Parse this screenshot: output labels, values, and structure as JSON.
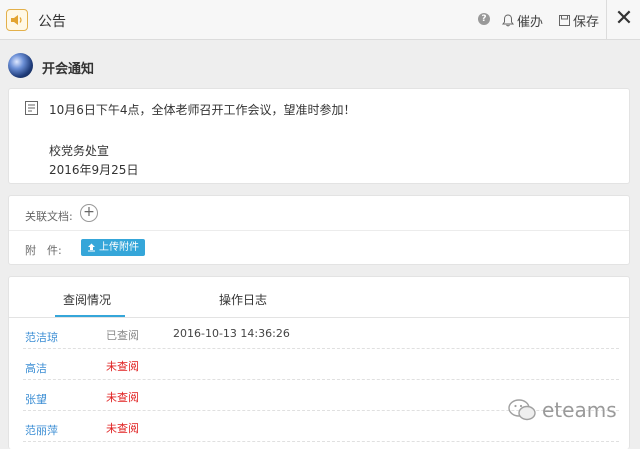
{
  "header": {
    "title": "公告",
    "help_symbol": "?",
    "urge_label": "催办",
    "save_label": "保存",
    "close_symbol": "✕"
  },
  "notice": {
    "title": "开会通知",
    "lines": [
      "10月6日下午4点，全体老师召开工作会议，望准时参加！",
      "校党务处宣",
      "2016年9月25日"
    ]
  },
  "related": {
    "docs_label": "关联文档:",
    "plus_symbol": "+",
    "attach_label": "附　件:",
    "upload_label": "上传附件"
  },
  "tabs": [
    {
      "label": "查阅情况",
      "active": true
    },
    {
      "label": "操作日志",
      "active": false
    }
  ],
  "readers": [
    {
      "name": "范洁琼",
      "status": "已查阅",
      "time": "2016-10-13 14:36:26",
      "read": true
    },
    {
      "name": "高洁",
      "status": "未查阅",
      "time": "",
      "read": false
    },
    {
      "name": "张望",
      "status": "未查阅",
      "time": "",
      "read": false
    },
    {
      "name": "范丽萍",
      "status": "未查阅",
      "time": "",
      "read": false
    }
  ],
  "watermark": {
    "text": "eteams"
  },
  "colors": {
    "accent": "#35a6d9",
    "unread": "#e02020",
    "link": "#3b8ed4"
  }
}
